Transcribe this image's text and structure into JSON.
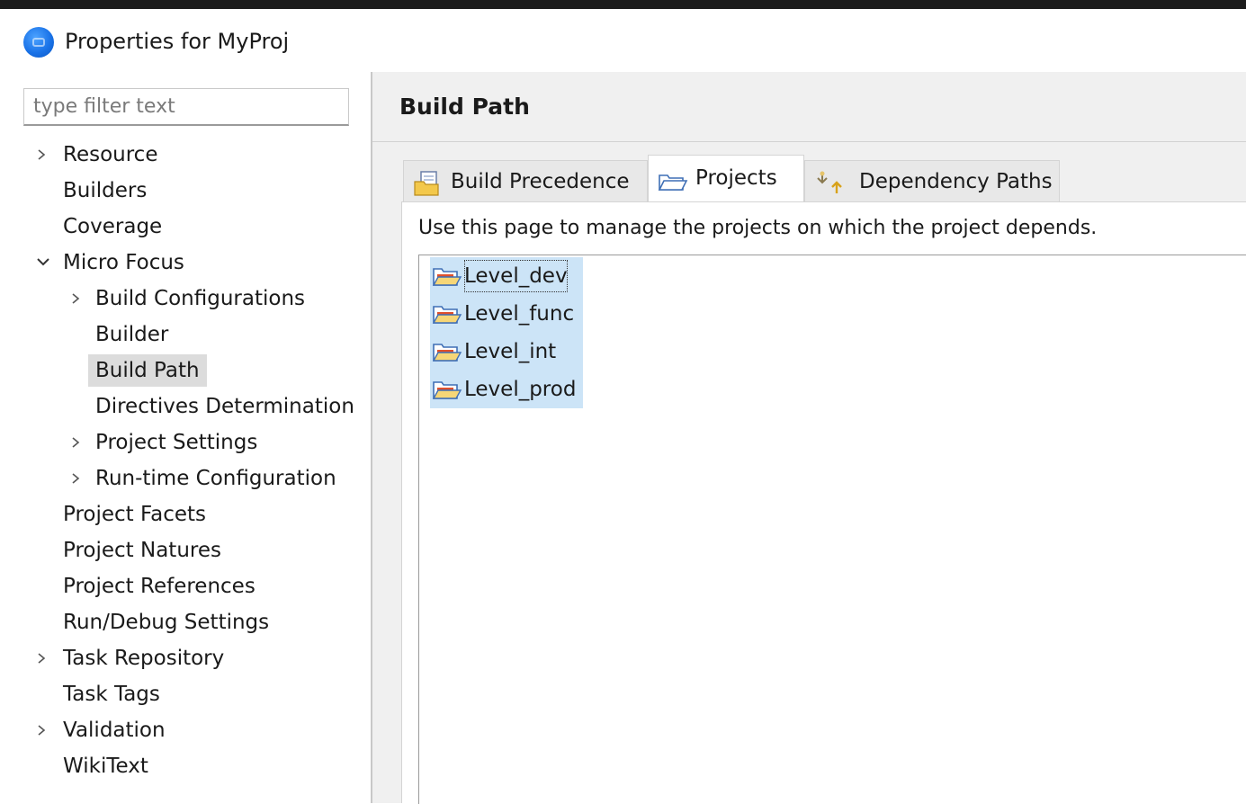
{
  "window": {
    "title": "Properties for MyProj"
  },
  "filter": {
    "placeholder": "type filter text",
    "value": ""
  },
  "tree": {
    "items": [
      {
        "label": "Resource",
        "expandable": true,
        "expanded": false
      },
      {
        "label": "Builders"
      },
      {
        "label": "Coverage"
      },
      {
        "label": "Micro Focus",
        "expandable": true,
        "expanded": true
      },
      {
        "label": "Build Configurations",
        "expandable": true,
        "expanded": false
      },
      {
        "label": "Builder"
      },
      {
        "label": "Build Path",
        "selected": true
      },
      {
        "label": "Directives Determination"
      },
      {
        "label": "Project Settings",
        "expandable": true,
        "expanded": false
      },
      {
        "label": "Run-time Configuration",
        "expandable": true,
        "expanded": false
      },
      {
        "label": "Project Facets"
      },
      {
        "label": "Project Natures"
      },
      {
        "label": "Project References"
      },
      {
        "label": "Run/Debug Settings"
      },
      {
        "label": "Task Repository",
        "expandable": true,
        "expanded": false
      },
      {
        "label": "Task Tags"
      },
      {
        "label": "Validation",
        "expandable": true,
        "expanded": false
      },
      {
        "label": "WikiText"
      }
    ]
  },
  "page": {
    "title": "Build Path",
    "tabs": [
      {
        "label": "Build Precedence",
        "icon": "build-precedence-icon"
      },
      {
        "label": "Projects",
        "icon": "open-folder-icon",
        "active": true
      },
      {
        "label": "Dependency Paths",
        "icon": "dependency-paths-icon"
      }
    ],
    "description": "Use this page to manage the projects on which the project depends.",
    "projects": [
      {
        "label": "Level_dev",
        "icon": "project-folder-icon"
      },
      {
        "label": "Level_func",
        "icon": "project-folder-icon"
      },
      {
        "label": "Level_int",
        "icon": "project-folder-icon"
      },
      {
        "label": "Level_prod",
        "icon": "project-folder-icon"
      }
    ]
  },
  "colors": {
    "selection": "#cce4f7",
    "tree_selection": "#dcdcdc",
    "accent": "#1a73e8"
  }
}
